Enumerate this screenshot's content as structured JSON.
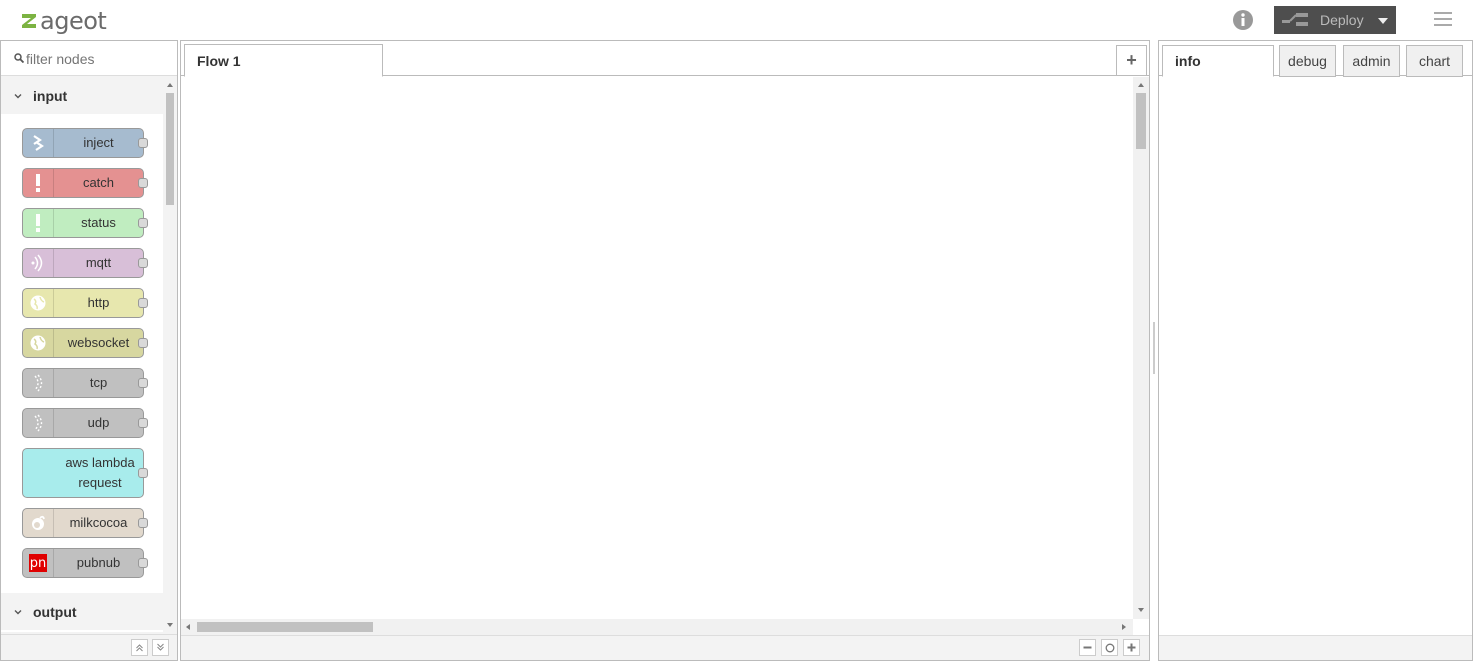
{
  "header": {
    "logo_text": "ageot",
    "deploy_label": "Deploy",
    "colors": {
      "header_bg": "#ffffff",
      "deploy_bg": "#4e4e4e",
      "logo_green": "#7cb342"
    }
  },
  "palette": {
    "search_placeholder": "filter nodes",
    "categories": [
      {
        "label": "input",
        "nodes": [
          {
            "label": "inject",
            "color": "#a6bbcf",
            "icon": "inject-arrow-icon"
          },
          {
            "label": "catch",
            "color": "#e49191",
            "icon": "alert-icon"
          },
          {
            "label": "status",
            "color": "#c0edc0",
            "icon": "alert-icon"
          },
          {
            "label": "mqtt",
            "color": "#d8bfd8",
            "icon": "bridge-icon"
          },
          {
            "label": "http",
            "color": "#e7e7ae",
            "icon": "white-globe-icon"
          },
          {
            "label": "websocket",
            "color": "#d7d7a0",
            "icon": "white-globe-icon"
          },
          {
            "label": "tcp",
            "color": "#c0c0c0",
            "icon": "bridge-dash-icon"
          },
          {
            "label": "udp",
            "color": "#c0c0c0",
            "icon": "bridge-dash-icon"
          },
          {
            "label": "aws lambda request",
            "color": "#a8ecec",
            "icon": "none"
          },
          {
            "label": "milkcocoa",
            "color": "#e2d9cd",
            "icon": "milkcocoa-icon"
          },
          {
            "label": "pubnub",
            "color": "#c0c0c0",
            "icon": "pubnub-icon"
          }
        ]
      },
      {
        "label": "output",
        "nodes": []
      }
    ]
  },
  "workspace": {
    "tabs": [
      {
        "label": "Flow 1"
      }
    ],
    "add_tab_label": "+"
  },
  "sidebar": {
    "tabs": [
      {
        "label": "info",
        "active": true
      },
      {
        "label": "debug",
        "active": false
      },
      {
        "label": "admin",
        "active": false
      },
      {
        "label": "chart",
        "active": false
      }
    ]
  }
}
